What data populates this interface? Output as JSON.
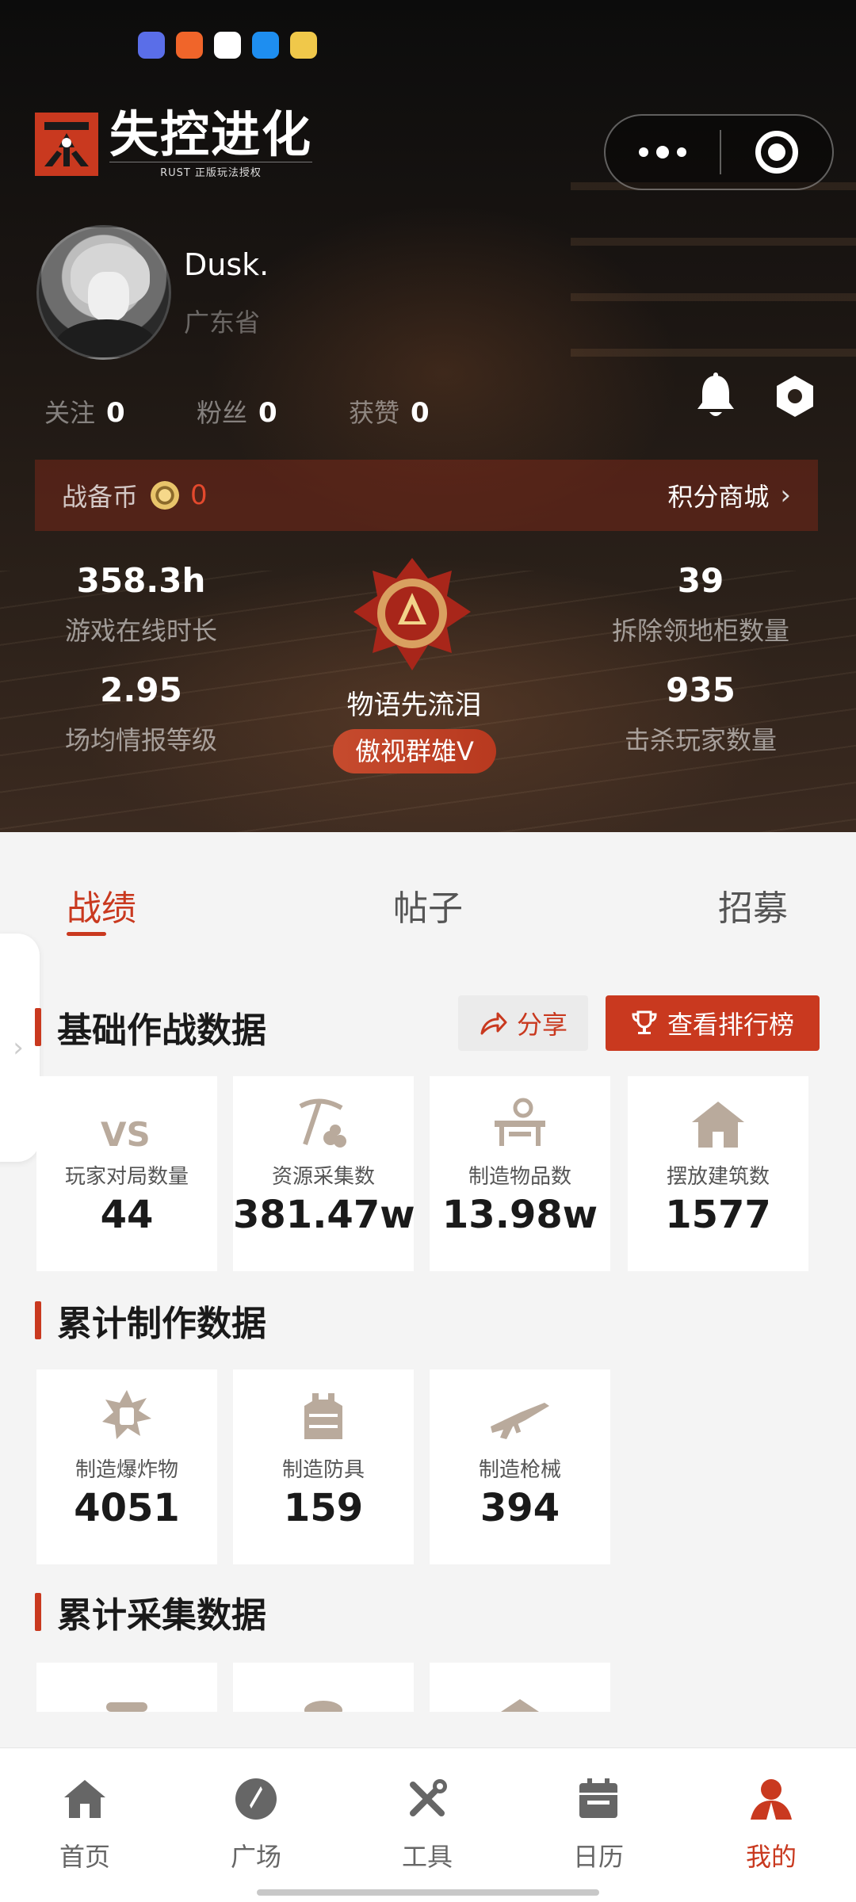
{
  "header": {
    "logo_title": "失控进化",
    "logo_subtitle": "RUST 正版玩法授权"
  },
  "profile": {
    "username": "Dusk.",
    "region": "广东省",
    "follow_label": "关注",
    "follow_count": "0",
    "fans_label": "粉丝",
    "fans_count": "0",
    "likes_label": "获赞",
    "likes_count": "0"
  },
  "coins": {
    "label": "战备币",
    "value": "0",
    "shop_label": "积分商城"
  },
  "stats": {
    "online_time_value": "358.3h",
    "online_time_label": "游戏在线时长",
    "intel_value": "2.95",
    "intel_label": "场均情报等级",
    "cabinets_value": "39",
    "cabinets_label": "拆除领地柜数量",
    "kills_value": "935",
    "kills_label": "击杀玩家数量"
  },
  "rank": {
    "title": "物语先流泪",
    "badge": "傲视群雄V"
  },
  "tabs": [
    "战绩",
    "帖子",
    "招募"
  ],
  "basic_section": {
    "title": "基础作战数据",
    "share_label": "分享",
    "leaderboard_label": "查看排行榜",
    "cards": [
      {
        "icon": "vs-icon",
        "label": "玩家对局数量",
        "value": "44"
      },
      {
        "icon": "pickaxe-icon",
        "label": "资源采集数",
        "value": "381.47w"
      },
      {
        "icon": "workbench-icon",
        "label": "制造物品数",
        "value": "13.98w"
      },
      {
        "icon": "house-icon",
        "label": "摆放建筑数",
        "value": "1577"
      }
    ]
  },
  "craft_section": {
    "title": "累计制作数据",
    "cards": [
      {
        "icon": "explosive-icon",
        "label": "制造爆炸物",
        "value": "4051"
      },
      {
        "icon": "armor-vest-icon",
        "label": "制造防具",
        "value": "159"
      },
      {
        "icon": "rifle-icon",
        "label": "制造枪械",
        "value": "394"
      }
    ]
  },
  "gather_section": {
    "title": "累计采集数据"
  },
  "bottom_nav": [
    {
      "icon": "home-icon",
      "label": "首页"
    },
    {
      "icon": "compass-icon",
      "label": "广场"
    },
    {
      "icon": "tools-icon",
      "label": "工具"
    },
    {
      "icon": "calendar-icon",
      "label": "日历"
    },
    {
      "icon": "user-icon",
      "label": "我的"
    }
  ],
  "colors": {
    "accent": "#c9391f",
    "coin_value": "#e3492d",
    "icon_tan": "#b9aa9c"
  }
}
